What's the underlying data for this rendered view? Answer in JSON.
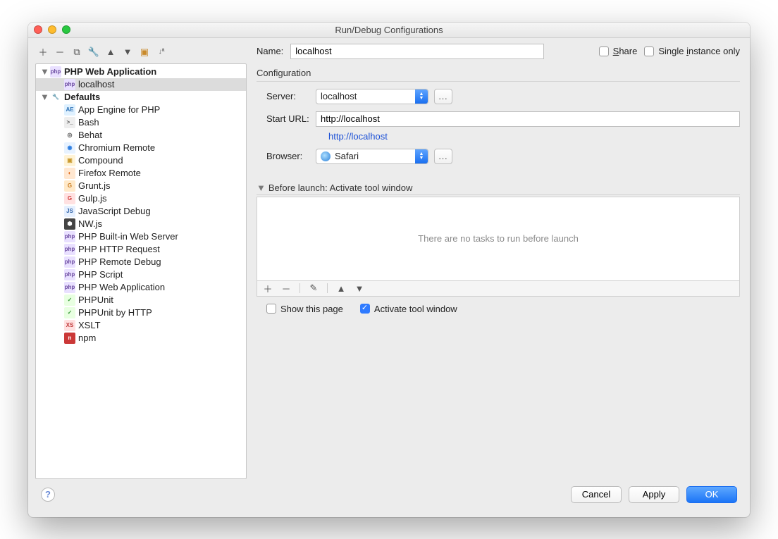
{
  "window": {
    "title": "Run/Debug Configurations"
  },
  "sidebar": {
    "groups": [
      {
        "name": "PHP Web Application",
        "expanded": true,
        "icon": "php-web-icon",
        "items": [
          {
            "label": "localhost",
            "icon": "php-web-icon",
            "selected": true
          }
        ]
      },
      {
        "name": "Defaults",
        "expanded": true,
        "icon": "wrench-icon",
        "items": [
          {
            "label": "App Engine for PHP",
            "icon": "appengine-icon"
          },
          {
            "label": "Bash",
            "icon": "bash-icon"
          },
          {
            "label": "Behat",
            "icon": "behat-icon"
          },
          {
            "label": "Chromium Remote",
            "icon": "chromium-icon"
          },
          {
            "label": "Compound",
            "icon": "compound-icon"
          },
          {
            "label": "Firefox Remote",
            "icon": "firefox-icon"
          },
          {
            "label": "Grunt.js",
            "icon": "grunt-icon"
          },
          {
            "label": "Gulp.js",
            "icon": "gulp-icon"
          },
          {
            "label": "JavaScript Debug",
            "icon": "js-debug-icon"
          },
          {
            "label": "NW.js",
            "icon": "nwjs-icon"
          },
          {
            "label": "PHP Built-in Web Server",
            "icon": "php-builtin-icon"
          },
          {
            "label": "PHP HTTP Request",
            "icon": "php-http-icon"
          },
          {
            "label": "PHP Remote Debug",
            "icon": "php-remote-icon"
          },
          {
            "label": "PHP Script",
            "icon": "php-script-icon"
          },
          {
            "label": "PHP Web Application",
            "icon": "php-web-icon"
          },
          {
            "label": "PHPUnit",
            "icon": "phpunit-icon"
          },
          {
            "label": "PHPUnit by HTTP",
            "icon": "phpunit-http-icon"
          },
          {
            "label": "XSLT",
            "icon": "xslt-icon"
          },
          {
            "label": "npm",
            "icon": "npm-icon"
          }
        ]
      }
    ]
  },
  "form": {
    "name_label": "Name:",
    "name_value": "localhost",
    "share_label": "Share",
    "share_checked": false,
    "single_instance_label": "Single instance only",
    "single_instance_checked": false,
    "config_section": "Configuration",
    "server_label": "Server:",
    "server_value": "localhost",
    "dots": "...",
    "starturl_label": "Start URL:",
    "starturl_value": "http://localhost",
    "url_preview": "http://localhost",
    "browser_label": "Browser:",
    "browser_value": "Safari",
    "before_launch_title": "Before launch: Activate tool window",
    "before_launch_empty": "There are no tasks to run before launch",
    "show_this_page_label": "Show this page",
    "show_this_page_checked": false,
    "activate_tw_label": "Activate tool window",
    "activate_tw_checked": true
  },
  "footer": {
    "cancel": "Cancel",
    "apply": "Apply",
    "ok": "OK"
  }
}
